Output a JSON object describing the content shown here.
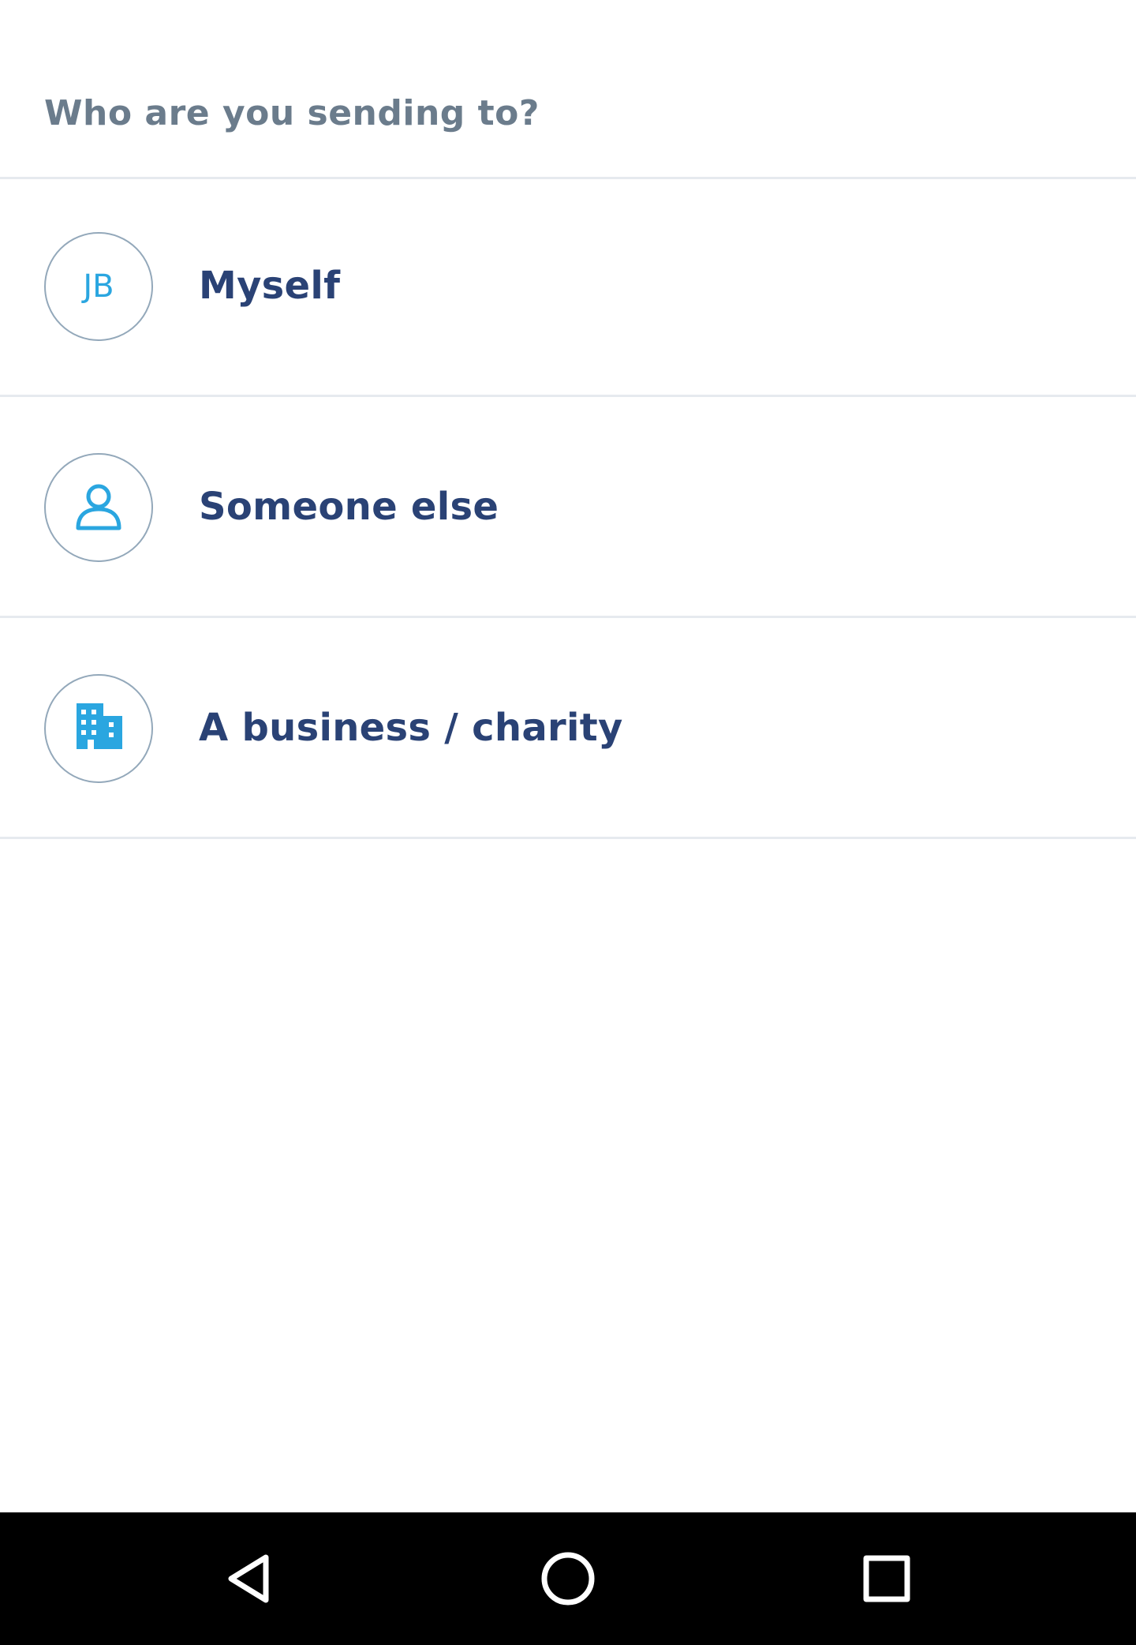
{
  "header": {
    "question": "Who are you sending to?"
  },
  "options": [
    {
      "label": "Myself",
      "avatar_text": "JB",
      "icon": "initials-avatar"
    },
    {
      "label": "Someone else",
      "icon": "person-icon"
    },
    {
      "label": "A business / charity",
      "icon": "building-icon"
    }
  ],
  "navbar": {
    "back_icon": "back-triangle-icon",
    "home_icon": "home-circle-icon",
    "recents_icon": "recents-square-icon"
  },
  "colors": {
    "accent": "#2aa6e0",
    "label": "#2a4275",
    "muted": "#6b7c8c",
    "divider": "#e6eaef"
  }
}
